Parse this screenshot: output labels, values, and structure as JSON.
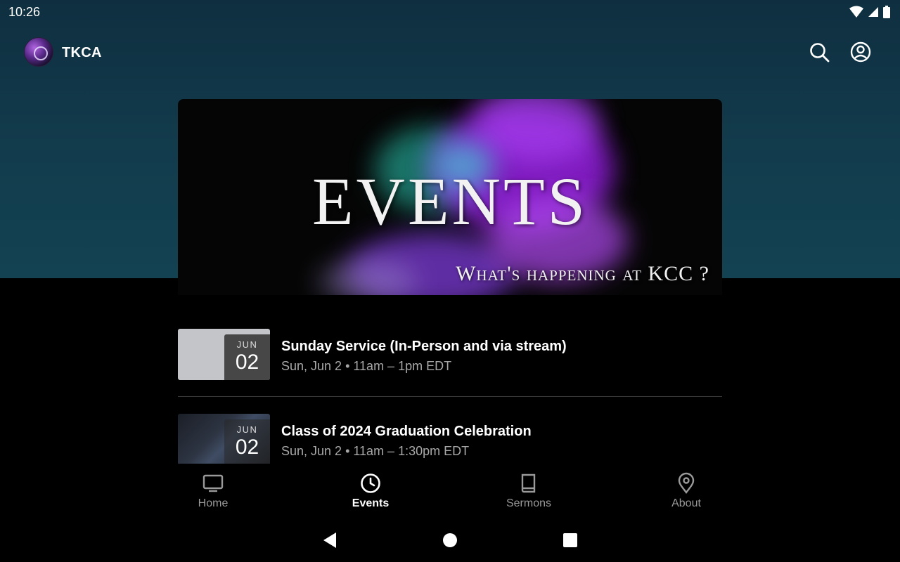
{
  "status_bar": {
    "time": "10:26",
    "icons": [
      "wifi-icon",
      "signal-icon",
      "battery-icon"
    ]
  },
  "app_bar": {
    "title": "TKCA",
    "actions": [
      "search-icon",
      "account-icon"
    ]
  },
  "banner": {
    "title": "EVENTS",
    "subtitle": "What's happening at KCC ?"
  },
  "events": [
    {
      "month": "JUN",
      "day": "02",
      "title": "Sunday Service (In-Person and via stream)",
      "time": "Sun, Jun 2 • 11am – 1pm EDT"
    },
    {
      "month": "JUN",
      "day": "02",
      "title": "Class of 2024 Graduation Celebration",
      "time": "Sun, Jun 2 • 11am – 1:30pm EDT"
    }
  ],
  "bottom_nav": {
    "items": [
      {
        "label": "Home",
        "icon": "tv-icon"
      },
      {
        "label": "Events",
        "icon": "clock-icon",
        "active": true
      },
      {
        "label": "Sermons",
        "icon": "book-icon"
      },
      {
        "label": "About",
        "icon": "location-pin-icon"
      }
    ]
  },
  "colors": {
    "header_bg": "#123d4e",
    "background": "#000000",
    "accent_purple": "#9b2fe0",
    "accent_teal": "#2ed0c4"
  }
}
